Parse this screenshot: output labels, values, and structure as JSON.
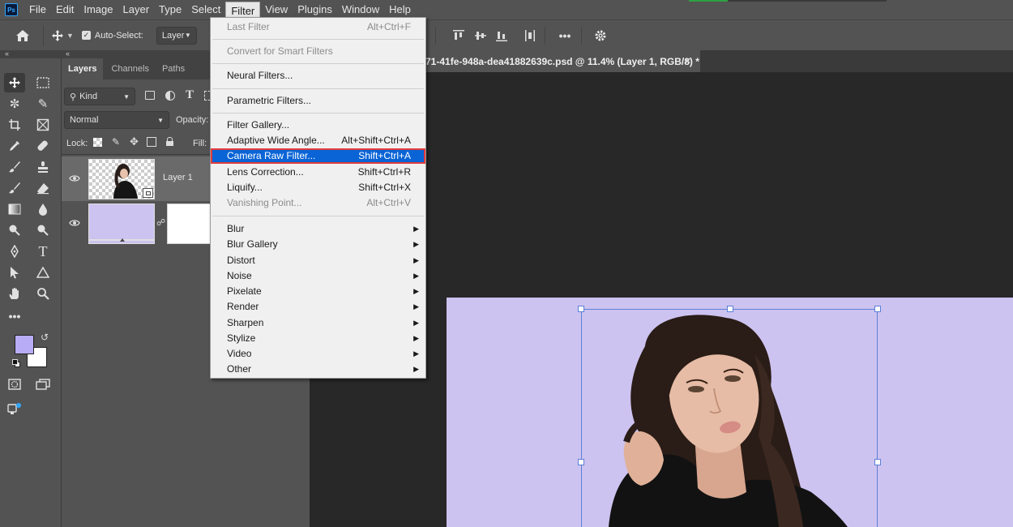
{
  "app": {
    "logo_text": "Ps"
  },
  "menubar": {
    "items": [
      "File",
      "Edit",
      "Image",
      "Layer",
      "Type",
      "Select",
      "Filter",
      "View",
      "Plugins",
      "Window",
      "Help"
    ],
    "active": "Filter"
  },
  "options": {
    "auto_select_label": "Auto-Select:",
    "auto_select_checked": true,
    "layer_select_value": "Layer"
  },
  "layers_panel": {
    "tabs": [
      "Layers",
      "Channels",
      "Paths"
    ],
    "active_tab": "Layers",
    "kind_filter": "Kind",
    "blend_mode": "Normal",
    "opacity_label": "Opacity:",
    "lock_label": "Lock:",
    "fill_label": "Fill:",
    "layers": [
      {
        "name": "Layer 1",
        "visible": true,
        "selected": true,
        "type": "smart-object"
      },
      {
        "name": "",
        "visible": true,
        "selected": false,
        "type": "fill-with-mask",
        "color": "#cdc3f0"
      }
    ]
  },
  "toolbar": {
    "foreground_color": "#b9acf7",
    "background_color": "#ffffff"
  },
  "document": {
    "tab_title": "71-41fe-948a-dea41882639c.psd @ 11.4% (Layer 1, RGB/8) *",
    "canvas_color": "#cdc3f0"
  },
  "filter_menu": {
    "groups": [
      [
        {
          "label": "Last Filter",
          "shortcut": "Alt+Ctrl+F",
          "disabled": true
        }
      ],
      [
        {
          "label": "Convert for Smart Filters",
          "disabled": true
        }
      ],
      [
        {
          "label": "Neural Filters..."
        }
      ],
      [
        {
          "label": "Parametric Filters..."
        }
      ],
      [
        {
          "label": "Filter Gallery..."
        },
        {
          "label": "Adaptive Wide Angle...",
          "shortcut": "Alt+Shift+Ctrl+A"
        },
        {
          "label": "Camera Raw Filter...",
          "shortcut": "Shift+Ctrl+A",
          "highlighted": true
        },
        {
          "label": "Lens Correction...",
          "shortcut": "Shift+Ctrl+R"
        },
        {
          "label": "Liquify...",
          "shortcut": "Shift+Ctrl+X"
        },
        {
          "label": "Vanishing Point...",
          "shortcut": "Alt+Ctrl+V",
          "disabled": true
        }
      ],
      [
        {
          "label": "Blur",
          "submenu": true
        },
        {
          "label": "Blur Gallery",
          "submenu": true
        },
        {
          "label": "Distort",
          "submenu": true
        },
        {
          "label": "Noise",
          "submenu": true
        },
        {
          "label": "Pixelate",
          "submenu": true
        },
        {
          "label": "Render",
          "submenu": true
        },
        {
          "label": "Sharpen",
          "submenu": true
        },
        {
          "label": "Stylize",
          "submenu": true
        },
        {
          "label": "Video",
          "submenu": true
        },
        {
          "label": "Other",
          "submenu": true
        }
      ]
    ]
  }
}
